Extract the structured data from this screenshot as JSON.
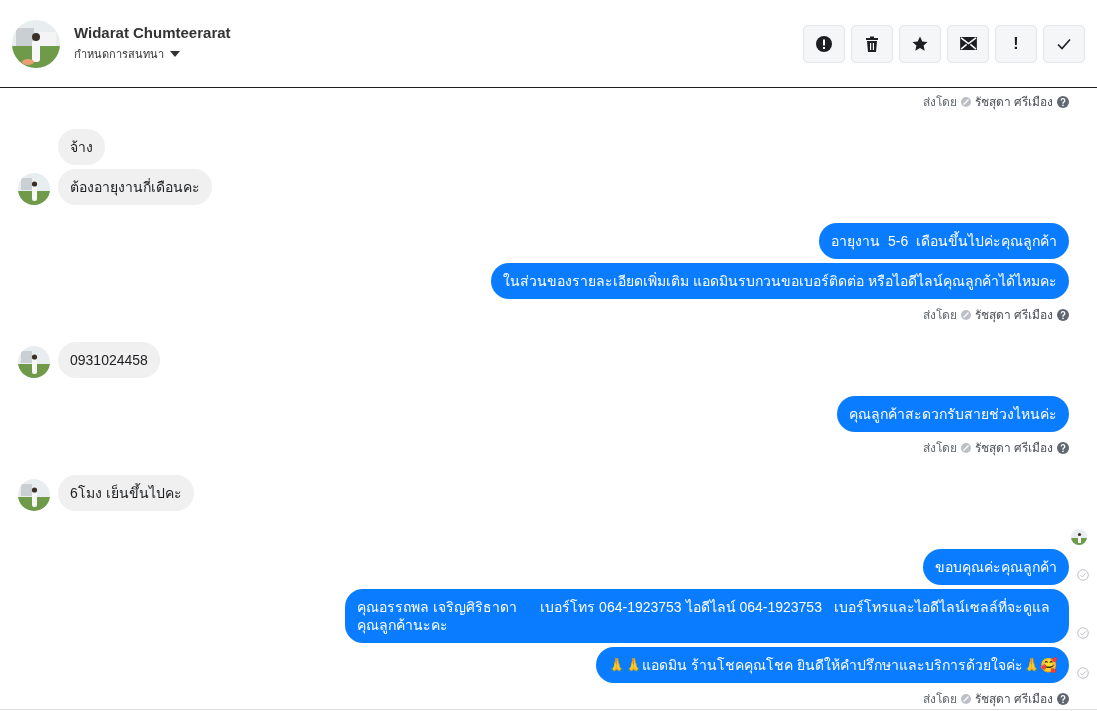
{
  "header": {
    "name": "Widarat Chumteerarat",
    "subtitle": "กำหนดการสนทนา",
    "buttons": [
      {
        "kind": "alert"
      },
      {
        "kind": "trash"
      },
      {
        "kind": "star"
      },
      {
        "kind": "mail"
      },
      {
        "kind": "text",
        "label": "!"
      },
      {
        "kind": "check"
      }
    ]
  },
  "groups": [
    {
      "kind": "outgoing",
      "sent_by": {
        "label": "ส่งโดย",
        "name": "รัชสุดา ศรีเมือง"
      }
    },
    {
      "kind": "incoming",
      "messages": [
        {
          "text": "จ้าง"
        },
        {
          "text": "ต้องอายุงานกี่เดือนคะ"
        }
      ]
    },
    {
      "kind": "outgoing",
      "messages": [
        {
          "text": "อายุงาน  5-6  เดือนขึ้นไปค่ะคุณลูกค้า"
        },
        {
          "text": "ในส่วนของรายละเอียดเพิ่มเติม แอดมินรบกวนขอเบอร์ติดต่อ หรือไอดีไลน์คุณลูกค้าได้ไหมคะ"
        }
      ],
      "sent_by": {
        "label": "ส่งโดย",
        "name": "รัชสุดา ศรีเมือง"
      }
    },
    {
      "kind": "incoming",
      "messages": [
        {
          "text": "0931024458"
        }
      ]
    },
    {
      "kind": "outgoing",
      "messages": [
        {
          "text": "คุณลูกค้าสะดวกรับสายช่วงไหนค่ะ"
        }
      ],
      "sent_by": {
        "label": "ส่งโดย",
        "name": "รัชสุดา ศรีเมือง"
      }
    },
    {
      "kind": "incoming",
      "messages": [
        {
          "text": "6โมง เย็นขึ้นไปคะ"
        }
      ]
    },
    {
      "kind": "outgoing",
      "seen": true,
      "messages": [
        {
          "text": "ขอบคุณค่ะคุณลูกค้า",
          "delivered": true
        },
        {
          "text": "คุณอรรถพล เจริญศิริธาดา      เบอร์โทร 064-1923753 ไอดีไลน์ 064-1923753   เบอร์โทรและไอดีไลน์เซลล์ที่จะดูแลคุณลูกค้านะคะ",
          "delivered": true
        },
        {
          "text": "🙏🙏แอดมิน ร้านโชคคุณโชค ยินดีให้คำปรึกษาและบริการด้วยใจค่ะ🙏🥰",
          "delivered": true
        }
      ],
      "sent_by": {
        "label": "ส่งโดย",
        "name": "รัชสุดา ศรีเมือง"
      }
    }
  ]
}
